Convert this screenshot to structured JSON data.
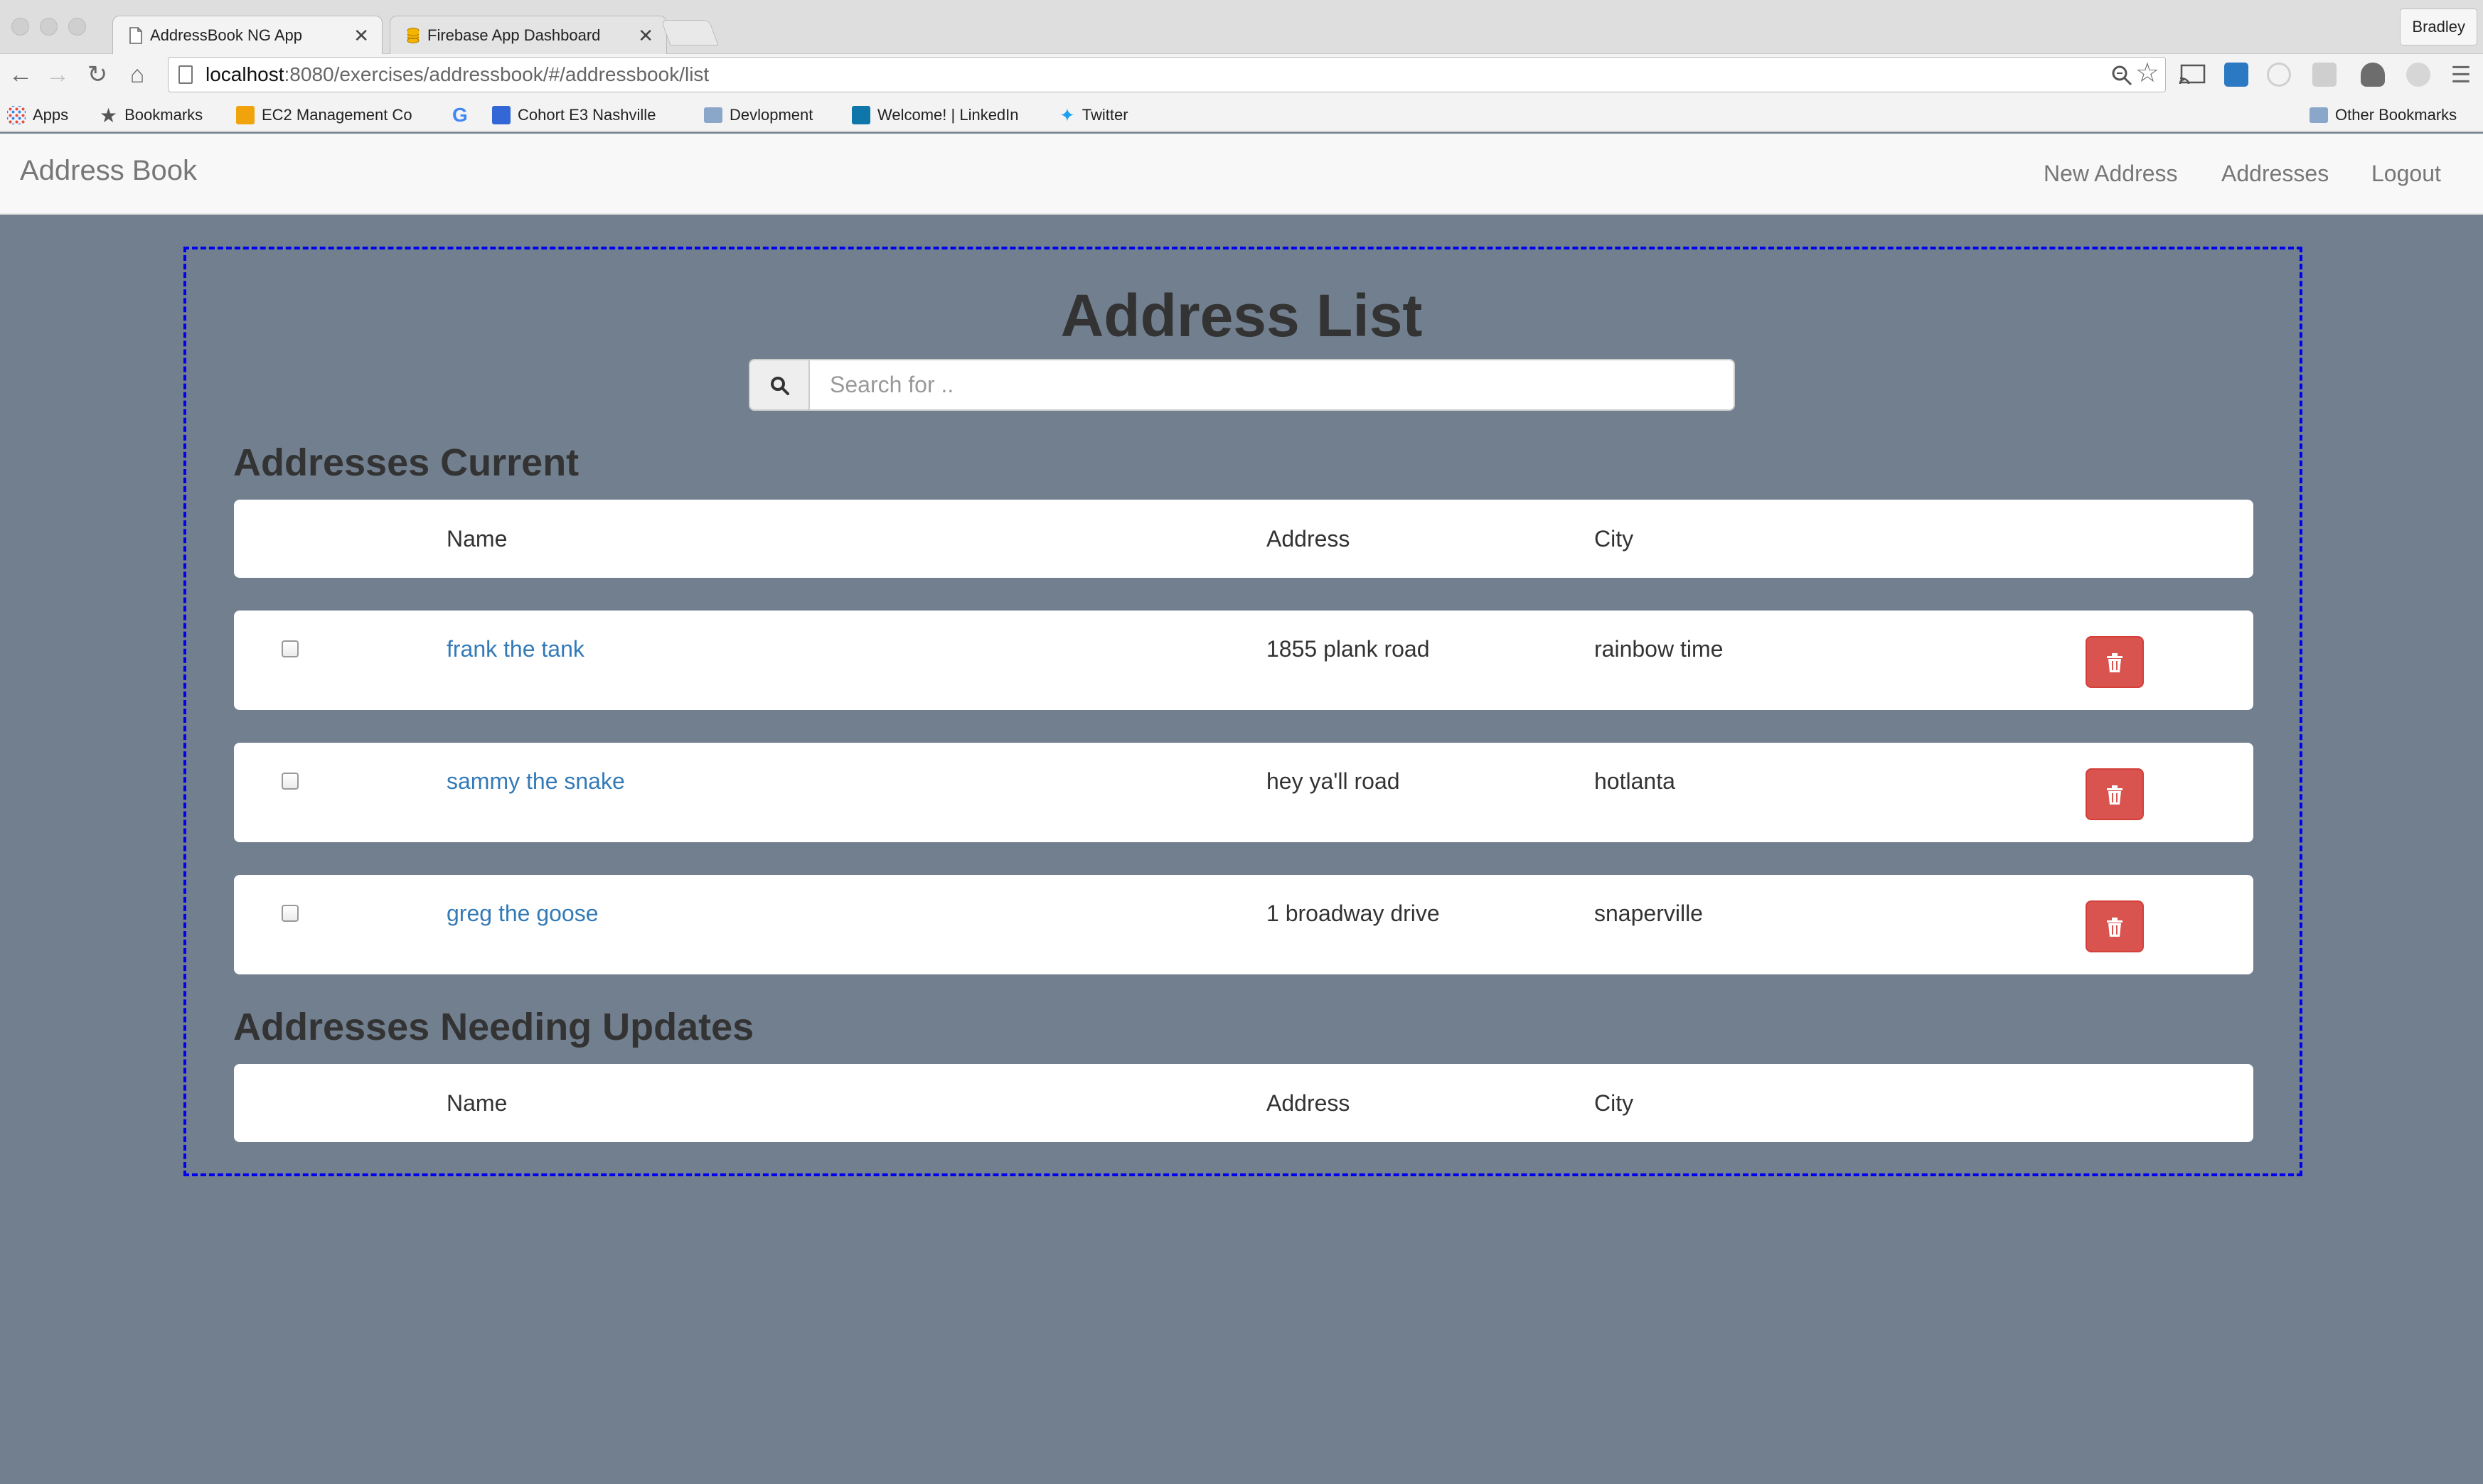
{
  "browser": {
    "tabs": [
      {
        "title": "AddressBook NG App",
        "close": "✕"
      },
      {
        "title": "Firebase App Dashboard",
        "close": "✕"
      }
    ],
    "profile_name": "Bradley",
    "url_host": "localhost",
    "url_rest": ":8080/exercises/addressbook/#/addressbook/list",
    "bookmarks": [
      "Apps",
      "Bookmarks",
      "EC2 Management Co",
      "Cohort E3 Nashville",
      "Devlopment",
      "Welcome! | LinkedIn",
      "Twitter"
    ],
    "other_bookmarks": "Other Bookmarks"
  },
  "navbar": {
    "brand": "Address Book",
    "links": [
      "New Address",
      "Addresses",
      "Logout"
    ]
  },
  "main": {
    "title": "Address List",
    "search_placeholder": "Search for ..",
    "current_section_title": "Addresses Current",
    "updates_section_title": "Addresses Needing Updates",
    "columns": [
      "Name",
      "Address",
      "City"
    ],
    "current_addresses": [
      {
        "name": "frank the tank",
        "address": "1855 plank road",
        "city": "rainbow time"
      },
      {
        "name": "sammy the snake",
        "address": "hey ya'll road",
        "city": "hotlanta"
      },
      {
        "name": "greg the goose",
        "address": "1 broadway drive",
        "city": "snaperville"
      }
    ]
  },
  "colors": {
    "page_background": "#717f8f",
    "link": "#337ab7",
    "delete_button": "#d9534f",
    "panel_border": "#0000ee"
  }
}
